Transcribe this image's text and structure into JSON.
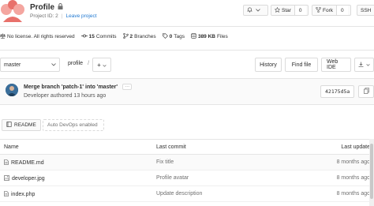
{
  "project": {
    "title": "Profile",
    "id_label": "Project ID: 2",
    "leave_label": "Leave project"
  },
  "header_buttons": {
    "notification_label": "",
    "star_label": "Star",
    "star_count": "0",
    "fork_label": "Fork",
    "fork_count": "0",
    "clone_label": "SSH"
  },
  "stats": {
    "license": "No license. All rights reserved",
    "commits_count": "15",
    "commits_label": "Commits",
    "branches_count": "2",
    "branches_label": "Branches",
    "tags_count": "0",
    "tags_label": "Tags",
    "files_size": "389 KB",
    "files_label": "Files"
  },
  "tree_bar": {
    "branch": "master",
    "path": "profile",
    "slash": "/",
    "add_symbol": "+",
    "history_label": "History",
    "find_file_label": "Find file",
    "web_ide_label": "Web IDE"
  },
  "last_commit": {
    "title": "Merge branch 'patch-1' into 'master'",
    "ellipsis": "···",
    "meta": "Developer authored 13 hours ago",
    "sha": "42175d5a"
  },
  "quick_links": {
    "readme_label": "README",
    "devops_label": "Auto DevOps enabled"
  },
  "table": {
    "headers": [
      "Name",
      "Last commit",
      "Last update"
    ],
    "rows": [
      {
        "name": "README.md",
        "commit": "Fix title",
        "updated": "8 months ago",
        "icon": "file-icon"
      },
      {
        "name": "developer.jpg",
        "commit": "Profile avatar",
        "updated": "8 months ago",
        "icon": "image-icon"
      },
      {
        "name": "index.php",
        "commit": "Update description",
        "updated": "8 months ago",
        "icon": "file-icon"
      }
    ]
  },
  "colors": {
    "link": "#1f78d1",
    "muted": "#707070",
    "border": "#dbdbdb"
  }
}
